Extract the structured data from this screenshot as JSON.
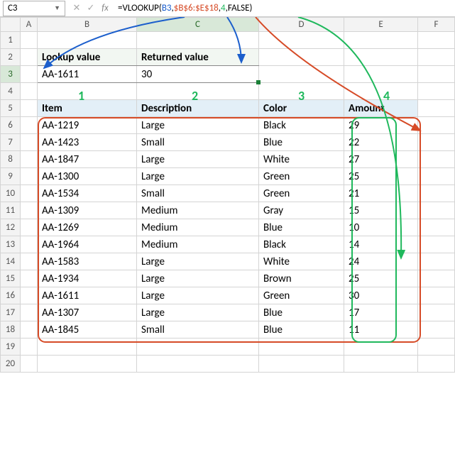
{
  "formula_bar": {
    "cell_ref": "C3",
    "formula_prefix": "=VLOOKUP(",
    "arg1": "B3",
    "sep": ",",
    "arg2": "$B$6:$E$18",
    "arg3": "4",
    "arg4": "FALSE",
    "formula_suffix": ")"
  },
  "columns": [
    "A",
    "B",
    "C",
    "D",
    "E",
    "F"
  ],
  "row_headers": [
    "1",
    "2",
    "3",
    "4",
    "5",
    "6",
    "7",
    "8",
    "9",
    "10",
    "11",
    "12",
    "13",
    "14",
    "15",
    "16",
    "17",
    "18",
    "19",
    "20"
  ],
  "lookup": {
    "label_lookup": "Lookup value",
    "label_return": "Returned value",
    "value_lookup": "AA-1611",
    "value_return": "30"
  },
  "col_nums": {
    "c1": "1",
    "c2": "2",
    "c3": "3",
    "c4": "4"
  },
  "headers": {
    "item": "Item",
    "desc": "Description",
    "color": "Color",
    "amount": "Amount"
  },
  "rows": [
    {
      "item": "AA-1219",
      "desc": "Large",
      "color": "Black",
      "amount": "29"
    },
    {
      "item": "AA-1423",
      "desc": "Small",
      "color": "Blue",
      "amount": "22"
    },
    {
      "item": "AA-1847",
      "desc": "Large",
      "color": "White",
      "amount": "27"
    },
    {
      "item": "AA-1300",
      "desc": "Large",
      "color": "Green",
      "amount": "25"
    },
    {
      "item": "AA-1534",
      "desc": "Small",
      "color": "Green",
      "amount": "21"
    },
    {
      "item": "AA-1309",
      "desc": "Medium",
      "color": "Gray",
      "amount": "15"
    },
    {
      "item": "AA-1269",
      "desc": "Medium",
      "color": "Blue",
      "amount": "10"
    },
    {
      "item": "AA-1964",
      "desc": "Medium",
      "color": "Black",
      "amount": "14"
    },
    {
      "item": "AA-1583",
      "desc": "Large",
      "color": "White",
      "amount": "24"
    },
    {
      "item": "AA-1934",
      "desc": "Large",
      "color": "Brown",
      "amount": "25"
    },
    {
      "item": "AA-1611",
      "desc": "Large",
      "color": "Green",
      "amount": "30"
    },
    {
      "item": "AA-1307",
      "desc": "Large",
      "color": "Blue",
      "amount": "17"
    },
    {
      "item": "AA-1845",
      "desc": "Small",
      "color": "Blue",
      "amount": "11"
    }
  ],
  "chart_data": {
    "type": "table",
    "title": "VLOOKUP example",
    "lookup_value": "AA-1611",
    "returned_value": 30,
    "formula": "=VLOOKUP(B3,$B$6:$E$18,4,FALSE)",
    "columns": [
      "Item",
      "Description",
      "Color",
      "Amount"
    ],
    "series": [
      {
        "name": "Item",
        "values": [
          "AA-1219",
          "AA-1423",
          "AA-1847",
          "AA-1300",
          "AA-1534",
          "AA-1309",
          "AA-1269",
          "AA-1964",
          "AA-1583",
          "AA-1934",
          "AA-1611",
          "AA-1307",
          "AA-1845"
        ]
      },
      {
        "name": "Description",
        "values": [
          "Large",
          "Small",
          "Large",
          "Large",
          "Small",
          "Medium",
          "Medium",
          "Medium",
          "Large",
          "Large",
          "Large",
          "Large",
          "Small"
        ]
      },
      {
        "name": "Color",
        "values": [
          "Black",
          "Blue",
          "White",
          "Green",
          "Green",
          "Gray",
          "Blue",
          "Black",
          "White",
          "Brown",
          "Green",
          "Blue",
          "Blue"
        ]
      },
      {
        "name": "Amount",
        "values": [
          29,
          22,
          27,
          25,
          21,
          15,
          10,
          14,
          24,
          25,
          30,
          17,
          11
        ]
      }
    ]
  }
}
